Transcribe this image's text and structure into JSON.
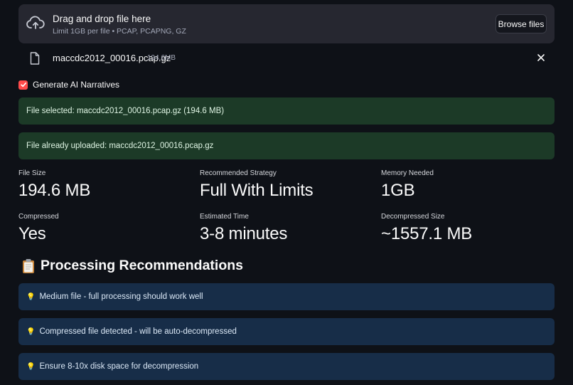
{
  "uploader": {
    "title": "Drag and drop file here",
    "limit": "Limit 1GB per file • PCAP, PCAPNG, GZ",
    "browse_label": "Browse files",
    "icon": "cloud-upload-icon"
  },
  "file": {
    "name": "maccdc2012_00016.pcap.gz",
    "size": "194.6MB",
    "icon": "file-icon"
  },
  "checkbox": {
    "label": "Generate AI Narratives",
    "checked": true
  },
  "alerts": {
    "selected": "File selected: maccdc2012_00016.pcap.gz (194.6 MB)",
    "uploaded": "File already uploaded: maccdc2012_00016.pcap.gz"
  },
  "metrics": [
    {
      "label": "File Size",
      "value": "194.6 MB"
    },
    {
      "label": "Recommended Strategy",
      "value": "Full With Limits"
    },
    {
      "label": "Memory Needed",
      "value": "1GB"
    },
    {
      "label": "Compressed",
      "value": "Yes"
    },
    {
      "label": "Estimated Time",
      "value": "3-8 minutes"
    },
    {
      "label": "Decompressed Size",
      "value": "~1557.1 MB"
    }
  ],
  "recommendations": {
    "title": "Processing Recommendations",
    "items": [
      "Medium file - full processing should work well",
      "Compressed file detected - will be auto-decompressed",
      "Ensure 8-10x disk space for decompression"
    ]
  },
  "colors": {
    "background": "#0e1117",
    "accent": "#ff4b4b",
    "success_bg": "#1c3a27",
    "info_bg": "#172d48"
  }
}
